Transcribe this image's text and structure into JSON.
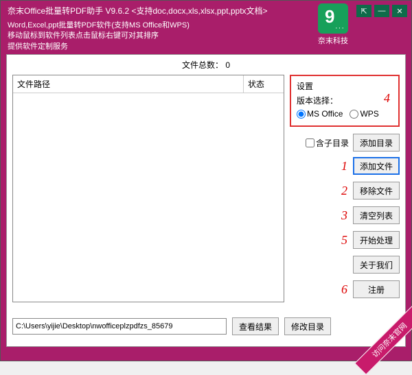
{
  "title": "奈末Office批量转PDF助手   V9.6.2  <支持doc,docx,xls,xlsx,ppt,pptx文档>",
  "subtitle_line1": "Word,Excel,ppt批量转PDF软件(支持MS Office和WPS)",
  "subtitle_line2": "移动鼠标到软件列表点击鼠标右键可对其排序",
  "subtitle_line3": "提供软件定制服务",
  "brand": "奈末科技",
  "win": {
    "pin": "⇱",
    "min": "—",
    "close": "✕"
  },
  "file_count_label": "文件总数：",
  "file_count_value": "0",
  "table": {
    "col_path": "文件路径",
    "col_status": "状态"
  },
  "settings": {
    "group_title": "设置",
    "version_label": "版本选择：",
    "opt_ms": "MS Office",
    "opt_wps": "WPS"
  },
  "include_sub": "含子目录",
  "buttons": {
    "add_dir": "添加目录",
    "add_file": "添加文件",
    "remove_file": "移除文件",
    "clear_list": "清空列表",
    "start": "开始处理",
    "about": "关于我们",
    "register": "注册"
  },
  "annotations": {
    "n1": "1",
    "n2": "2",
    "n3": "3",
    "n4": "4",
    "n5": "5",
    "n6": "6"
  },
  "path_value": "C:\\Users\\yijie\\Desktop\\nwofficeplzpdfzs_85679",
  "view_result": "查看结果",
  "modify_dir": "修改目录",
  "ribbon": "访问奈末官网"
}
